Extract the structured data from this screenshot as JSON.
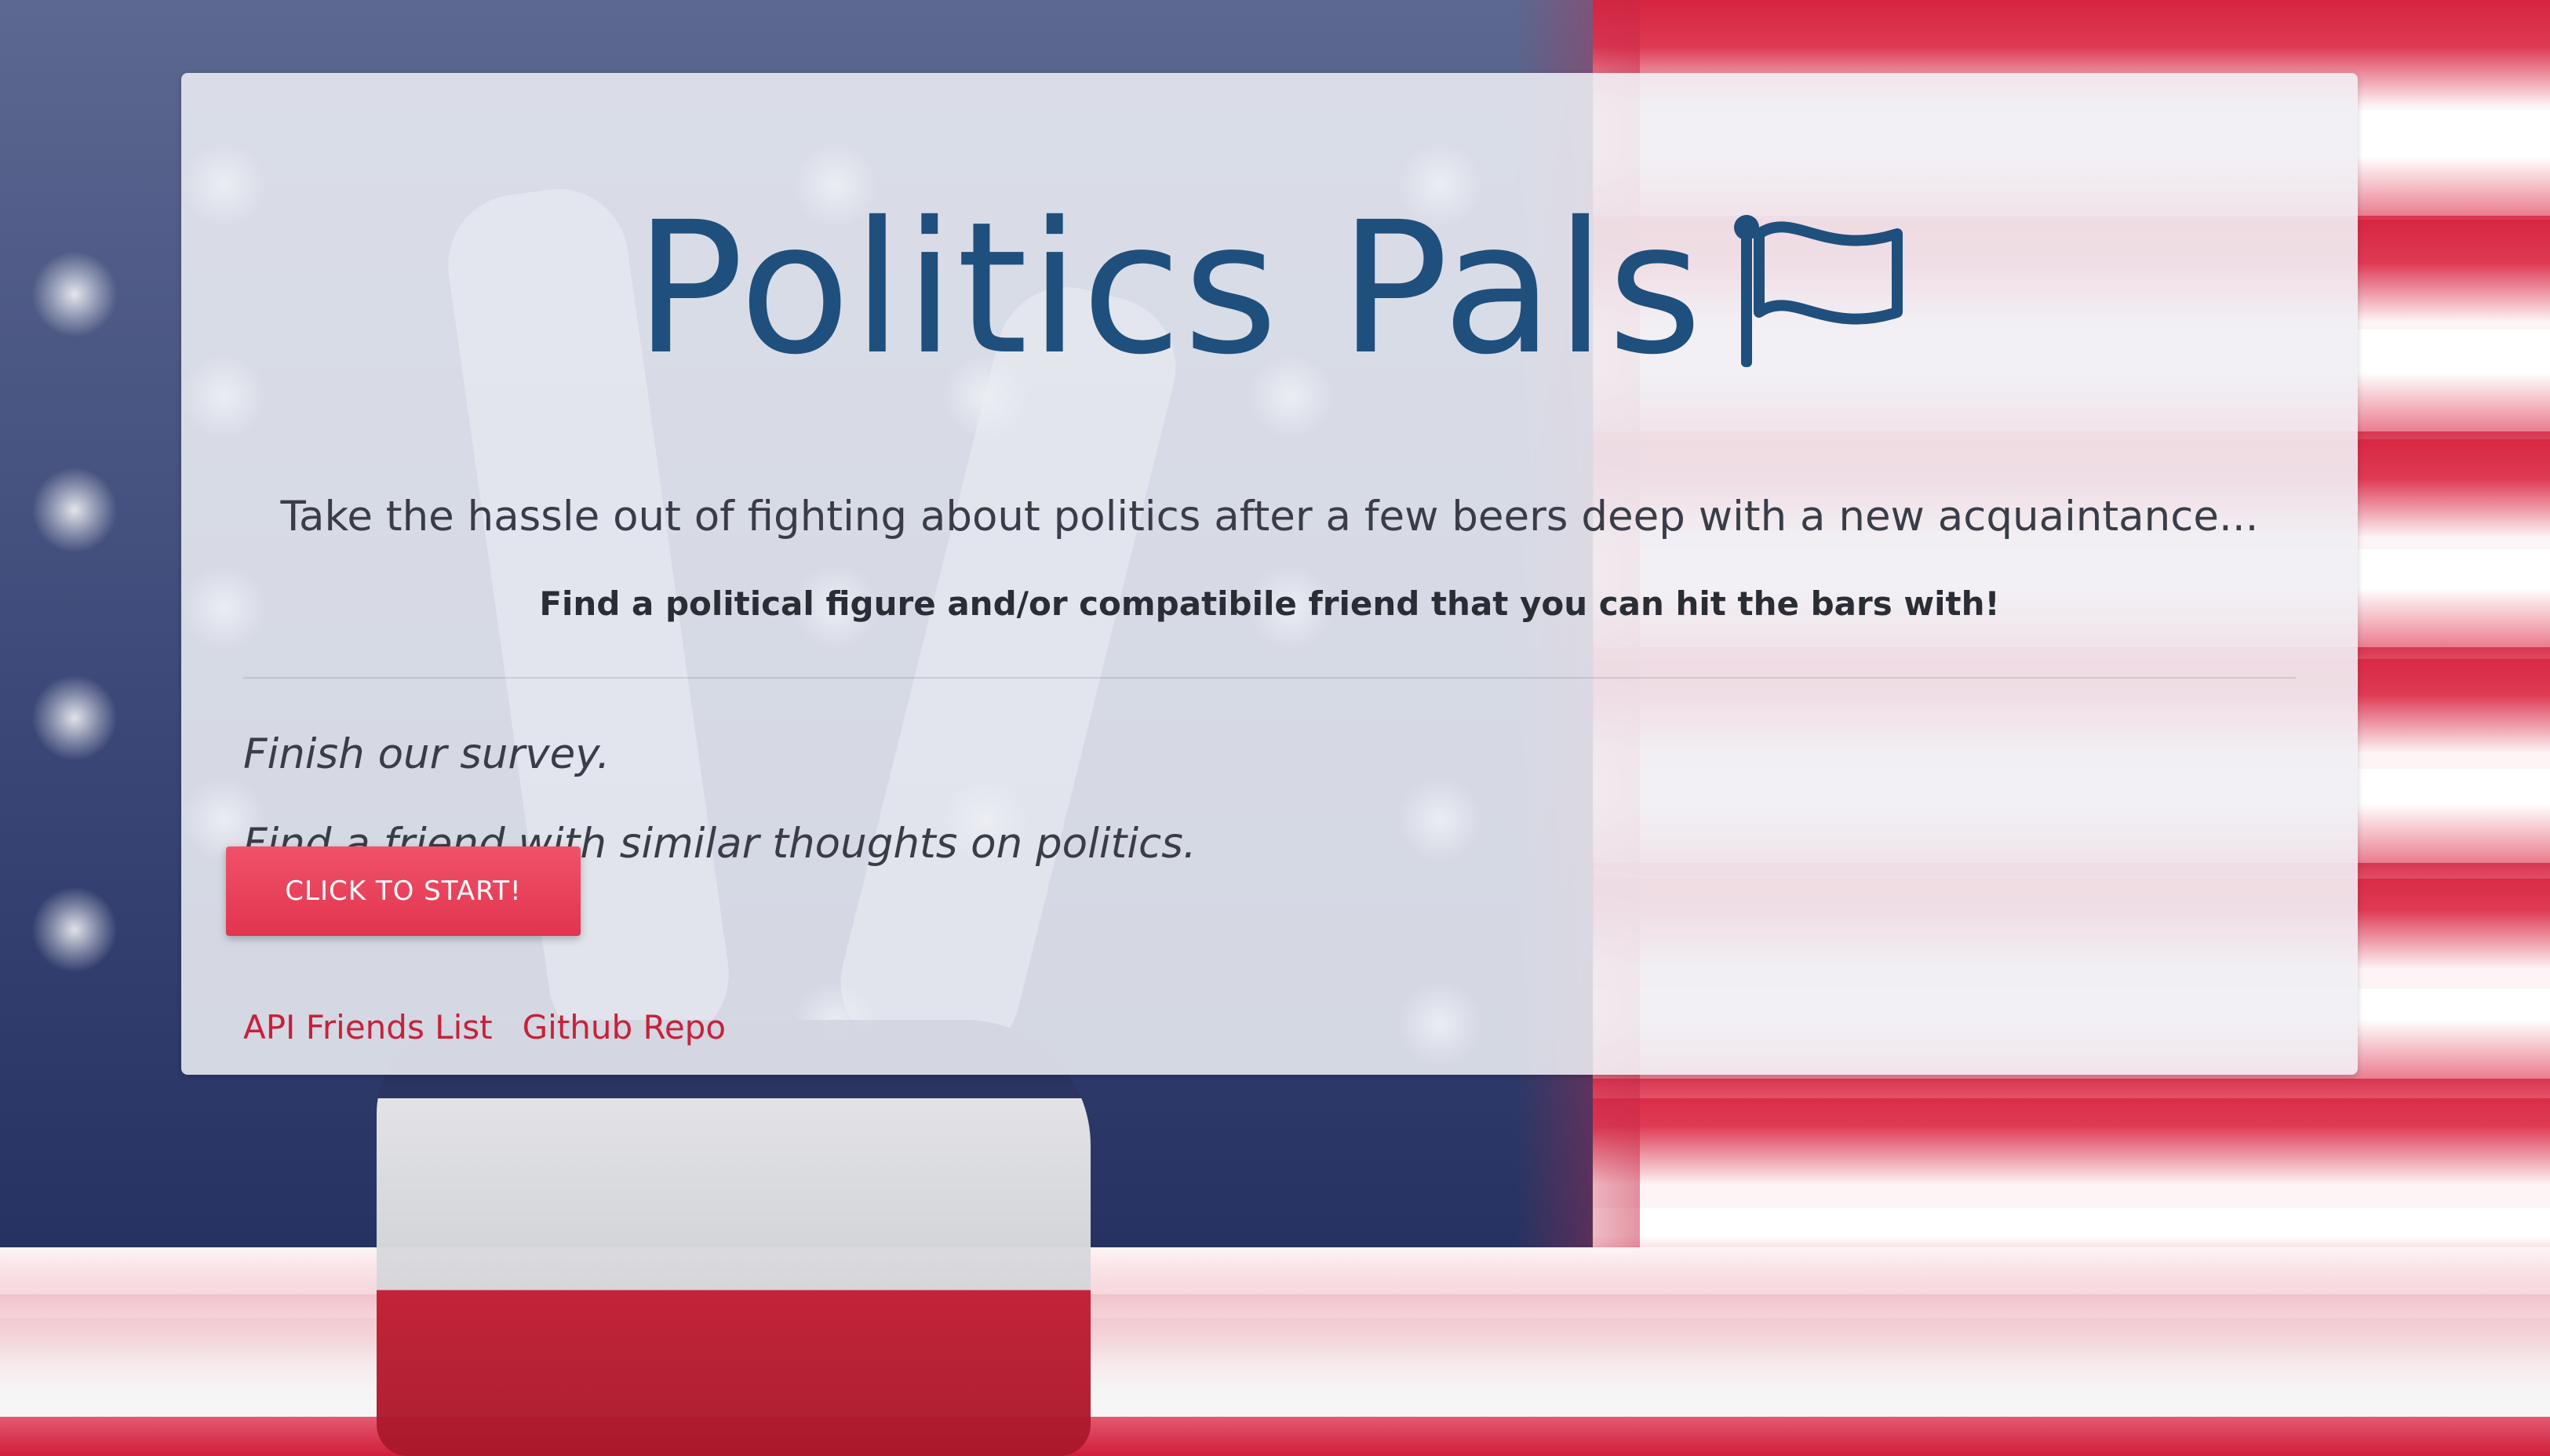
{
  "page": {
    "title": "Politics Pals",
    "lead": "Take the hassle out of fighting about politics after a few beers deep with a new acquaintance...",
    "subheading": "Find a political figure and/or compatibile friend that you can hit the bars with!",
    "steps": [
      "Finish our survey.",
      "Find a friend with similar thoughts on politics."
    ],
    "start_button": "CLICK TO START!",
    "links": [
      {
        "label": "API Friends List"
      },
      {
        "label": "Github Repo"
      }
    ]
  },
  "icons": {
    "title_icon": "flag-icon"
  },
  "colors": {
    "title": "#1f4f7d",
    "button": "#e83a55",
    "link": "#c8203a",
    "card_bg": "#eceef4"
  }
}
